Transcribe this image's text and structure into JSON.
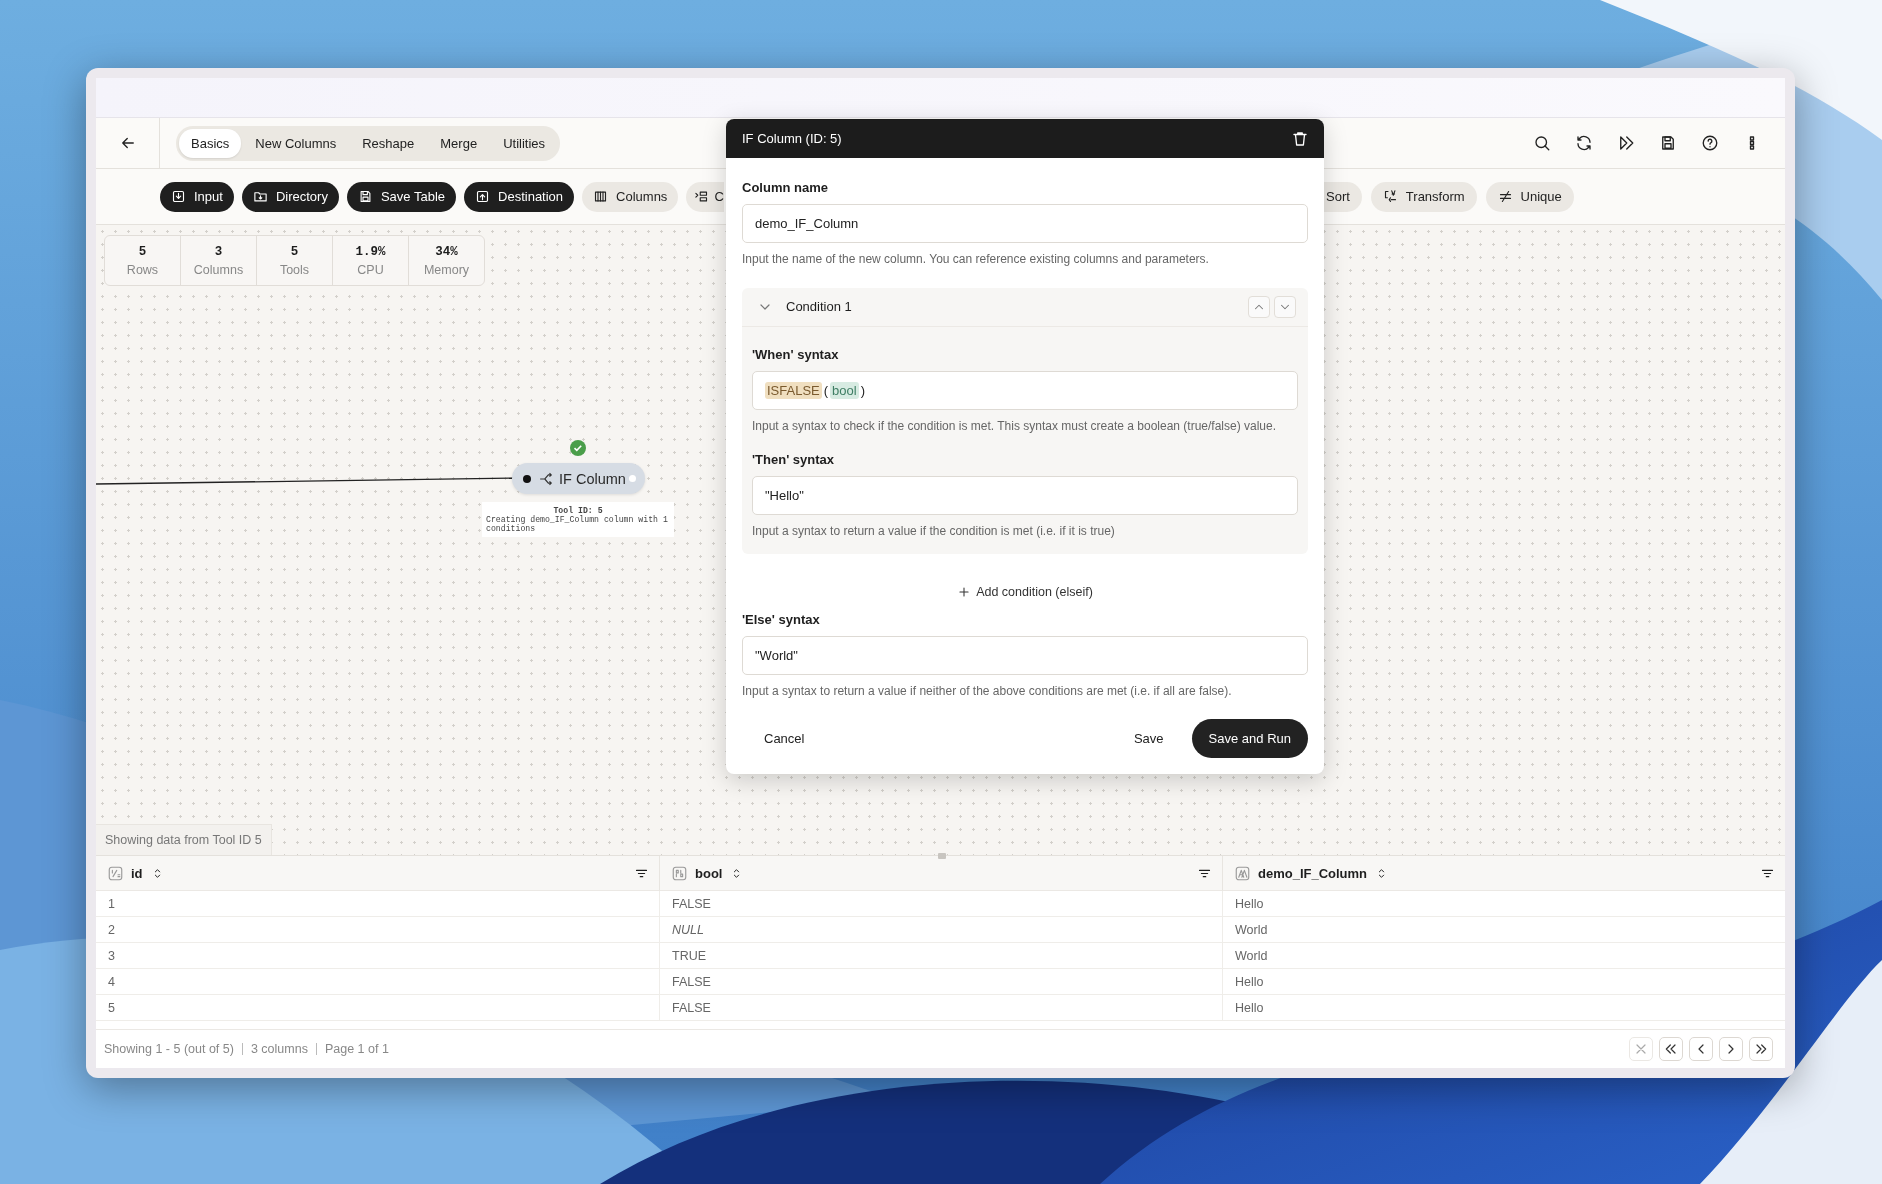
{
  "header": {
    "tabs": [
      {
        "label": "Basics",
        "selected": true
      },
      {
        "label": "New Columns",
        "selected": false
      },
      {
        "label": "Reshape",
        "selected": false
      },
      {
        "label": "Merge",
        "selected": false
      },
      {
        "label": "Utilities",
        "selected": false
      }
    ]
  },
  "toolbar": {
    "left": [
      {
        "label": "Input",
        "kind": "dark"
      },
      {
        "label": "Directory",
        "kind": "dark"
      },
      {
        "label": "Save Table",
        "kind": "dark"
      },
      {
        "label": "Destination",
        "kind": "dark"
      },
      {
        "label": "Columns",
        "kind": "light"
      },
      {
        "label": "C",
        "kind": "cut"
      }
    ],
    "right": [
      {
        "label": "Sort",
        "kind": "cut"
      },
      {
        "label": "Transform",
        "kind": "light"
      },
      {
        "label": "Unique",
        "kind": "light"
      }
    ]
  },
  "stats": [
    {
      "value": "5",
      "label": "Rows"
    },
    {
      "value": "3",
      "label": "Columns"
    },
    {
      "value": "5",
      "label": "Tools"
    },
    {
      "value": "1.9%",
      "label": "CPU"
    },
    {
      "value": "34%",
      "label": "Memory"
    }
  ],
  "node": {
    "title": "IF Column",
    "done": true,
    "info_heading": "Tool ID: 5",
    "info_text": "Creating demo_IF_Column column with 1 conditions"
  },
  "data_source": "Showing data from Tool ID 5",
  "table": {
    "columns": [
      {
        "name": "id"
      },
      {
        "name": "bool"
      },
      {
        "name": "demo_IF_Column"
      }
    ],
    "rows": [
      {
        "cells": [
          {
            "text": "1",
            "null": false
          },
          {
            "text": "FALSE",
            "null": false
          },
          {
            "text": "Hello",
            "null": false
          }
        ]
      },
      {
        "cells": [
          {
            "text": "2",
            "null": false
          },
          {
            "text": "NULL",
            "null": true
          },
          {
            "text": "World",
            "null": false
          }
        ]
      },
      {
        "cells": [
          {
            "text": "3",
            "null": false
          },
          {
            "text": "TRUE",
            "null": false
          },
          {
            "text": "World",
            "null": false
          }
        ]
      },
      {
        "cells": [
          {
            "text": "4",
            "null": false
          },
          {
            "text": "FALSE",
            "null": false
          },
          {
            "text": "Hello",
            "null": false
          }
        ]
      },
      {
        "cells": [
          {
            "text": "5",
            "null": false
          },
          {
            "text": "FALSE",
            "null": false
          },
          {
            "text": "Hello",
            "null": false
          }
        ]
      }
    ]
  },
  "footer": {
    "summary": [
      "Showing 1 - 5 (out of 5)",
      "3 columns",
      "Page 1 of 1"
    ],
    "pager": [
      {
        "disabled": true
      },
      {
        "disabled": false
      },
      {
        "disabled": false
      },
      {
        "disabled": false
      },
      {
        "disabled": false
      }
    ]
  },
  "dialog": {
    "title": "IF Column (ID: 5)",
    "column_name": {
      "label": "Column name",
      "value": "demo_IF_Column",
      "help": "Input the name of the new column. You can reference existing columns and parameters."
    },
    "conditions": [
      {
        "title": "Condition 1",
        "expanded": true,
        "when": {
          "label": "'When' syntax",
          "tokens": [
            {
              "kind": "function",
              "text": "ISFALSE"
            },
            {
              "kind": "punct",
              "text": "("
            },
            {
              "kind": "column",
              "text": "bool"
            },
            {
              "kind": "punct",
              "text": ")"
            }
          ],
          "help": "Input a syntax to check if the condition is met. This syntax must create a boolean (true/false) value."
        },
        "then": {
          "label": "'Then' syntax",
          "value": "\"Hello\"",
          "help": "Input a syntax to return a value if the condition is met (i.e. if it is true)"
        }
      }
    ],
    "add_condition": "Add condition (elseif)",
    "else": {
      "label": "'Else' syntax",
      "value": "\"World\"",
      "help": "Input a syntax to return a value if neither of the above conditions are met (i.e. if all are false)."
    },
    "buttons": [
      {
        "label": "Cancel",
        "kind": "text"
      },
      {
        "label": "Save",
        "kind": "text"
      },
      {
        "label": "Save and Run",
        "kind": "primary"
      }
    ]
  }
}
